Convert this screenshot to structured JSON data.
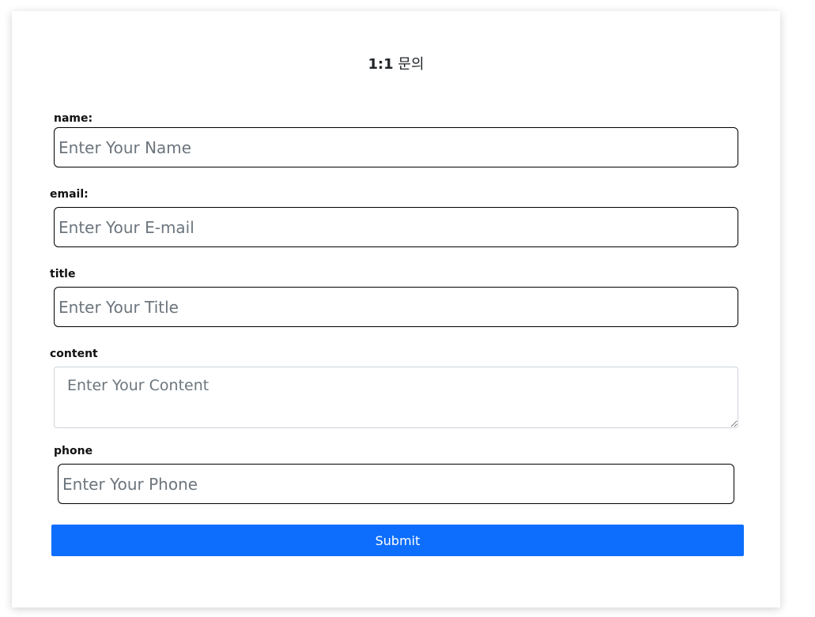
{
  "form": {
    "title_bold": "1:1",
    "title_rest": " 문의",
    "name": {
      "label": "name:",
      "placeholder": "Enter Your Name"
    },
    "email": {
      "label": "email:",
      "placeholder": "Enter Your E-mail"
    },
    "title_field": {
      "label": "title",
      "placeholder": "Enter Your Title"
    },
    "content": {
      "label": "content",
      "placeholder": "Enter Your Content"
    },
    "phone": {
      "label": "phone",
      "placeholder": "Enter Your Phone"
    },
    "submit_label": "Submit"
  },
  "colors": {
    "accent": "#0d6efd",
    "text": "#212529",
    "placeholder": "#6c757d"
  }
}
